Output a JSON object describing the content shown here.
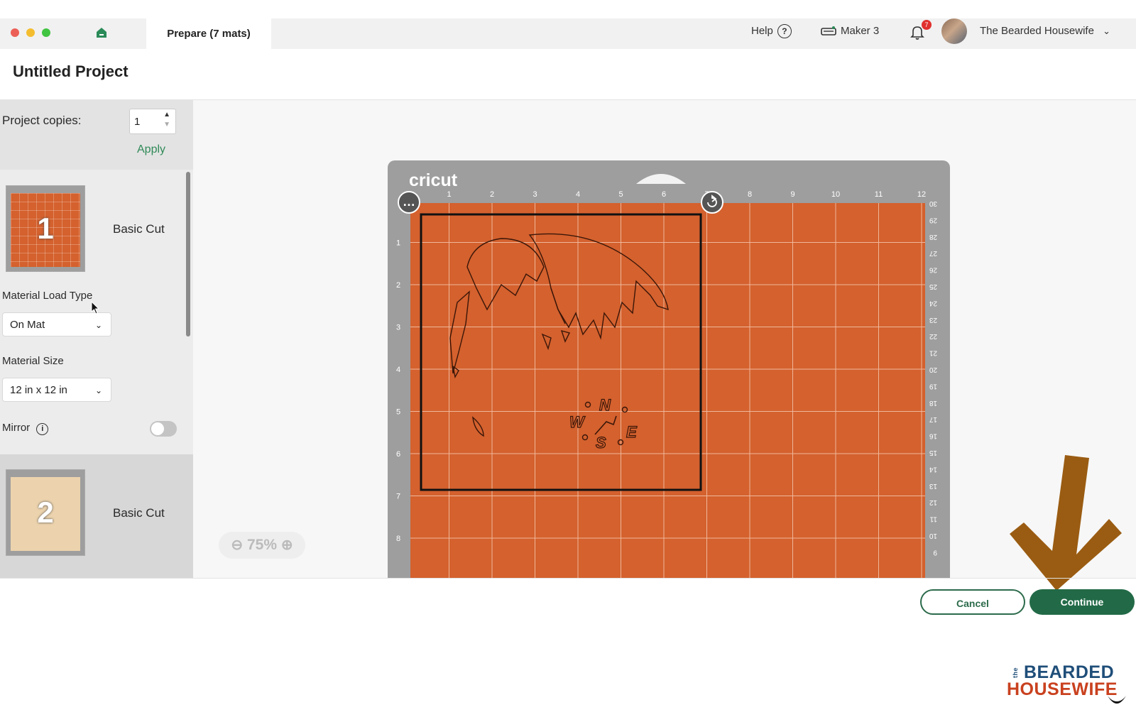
{
  "app": {
    "tab_label": "Prepare (7 mats)",
    "project_title": "Untitled Project"
  },
  "topbar": {
    "help_label": "Help",
    "machine_label": "Maker 3",
    "notification_count": "7",
    "user_name": "The Bearded Housewife"
  },
  "left_panel": {
    "copies_label": "Project copies:",
    "copies_value": "1",
    "apply_label": "Apply",
    "material_load_label": "Material Load Type",
    "material_load_value": "On Mat",
    "material_size_label": "Material Size",
    "material_size_value": "12 in x 12 in",
    "mirror_label": "Mirror",
    "mirror_on": false,
    "mats": [
      {
        "number": "1",
        "label": "Basic Cut",
        "color": "#d4612e"
      },
      {
        "number": "2",
        "label": "Basic Cut",
        "color": "#ecd3ad"
      }
    ]
  },
  "mat": {
    "brand": "cricut",
    "color": "#d4612e",
    "top_ruler": [
      "1",
      "2",
      "3",
      "4",
      "5",
      "6",
      "7",
      "8",
      "9",
      "10",
      "11",
      "12"
    ],
    "left_ruler": [
      "1",
      "2",
      "3",
      "4",
      "5",
      "6",
      "7",
      "8"
    ],
    "right_ruler": [
      "30",
      "29",
      "28",
      "27",
      "26",
      "25",
      "24",
      "23",
      "22",
      "21",
      "20",
      "19",
      "18",
      "17",
      "16",
      "15",
      "14",
      "13",
      "12",
      "11",
      "10",
      "9"
    ],
    "compass": [
      "N",
      "W",
      "E",
      "S"
    ]
  },
  "zoom": {
    "level": "75%"
  },
  "footer": {
    "cancel_label": "Cancel",
    "continue_label": "Continue"
  },
  "watermark": {
    "line_small": "the",
    "line1": "BEARDED",
    "line2": "HOUSEWIFE"
  },
  "colors": {
    "accent_green": "#226a47",
    "mat_orange": "#d4612e",
    "arrow_brown": "#9a5c12"
  }
}
